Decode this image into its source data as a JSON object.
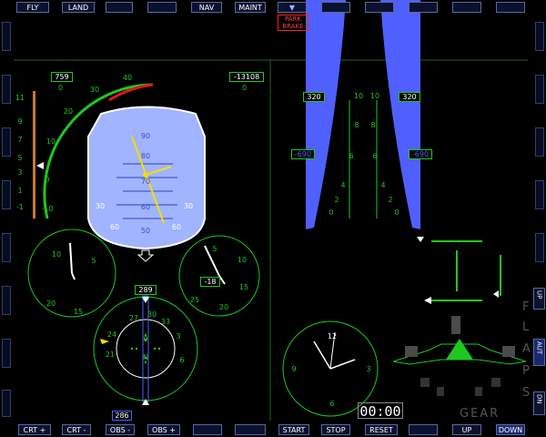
{
  "top_bar": {
    "buttons": [
      "FLY",
      "LAND",
      "",
      "",
      "NAV",
      "MAINT",
      "▼",
      "",
      "",
      "",
      "",
      ""
    ]
  },
  "bottom_bar": {
    "buttons": [
      "CRT +",
      "CRT -",
      "OBS -",
      "OBS +",
      "",
      "",
      "START",
      "STOP",
      "RESET",
      "",
      "UP",
      "DOWN"
    ]
  },
  "right_side": {
    "flaps_up": "UP",
    "flaps_auto": "AUT",
    "flaps_down": "DN",
    "flaps_label": [
      "F",
      "L",
      "A",
      "P",
      "S"
    ],
    "gear_label": "GEAR"
  },
  "warnings": {
    "park_brake": [
      "PARK",
      "BRAKE"
    ]
  },
  "airspeed": {
    "top_value": "759",
    "top_sub": "0",
    "ticks": [
      "-10",
      "0",
      "10",
      "20",
      "30",
      "40"
    ]
  },
  "altimeter": {
    "value": "-13108",
    "sub": "0"
  },
  "vsi": {
    "ticks": [
      "11",
      "9",
      "7",
      "5",
      "3",
      "1",
      "-1"
    ],
    "ticks2": [
      "10",
      "8",
      "6",
      "4",
      "2",
      "0"
    ]
  },
  "attitude": {
    "pitch_labels": [
      "90",
      "80",
      "70",
      "60",
      "50"
    ],
    "side_labels": [
      "30",
      "30",
      "60",
      "60"
    ]
  },
  "gauges": {
    "left_clock_ticks": [
      "10",
      "5",
      "15",
      "20"
    ],
    "right_clock_ticks": [
      "5",
      "10",
      "15",
      "20",
      "25"
    ],
    "right_clock_value": "-18",
    "heading_value": "289",
    "heading_ticks": [
      "27",
      "30",
      "33",
      "24",
      "21",
      "0",
      "N",
      "3",
      "6"
    ],
    "course_value": "286",
    "analog_clock_ticks": [
      "12",
      "3",
      "6",
      "9"
    ]
  },
  "engines": {
    "left_value": "320",
    "right_value": "320",
    "left_bottom": "-690",
    "right_bottom": "-690",
    "scale_left": [
      "10",
      "8",
      "6",
      "4",
      "2",
      "0"
    ],
    "scale_right": [
      "10",
      "8",
      "6",
      "4",
      "2",
      "0"
    ]
  },
  "timer": {
    "display": "00:00"
  },
  "colors": {
    "green": "#1ec81e",
    "blue": "#5060ff",
    "sky": "#a0b4ff",
    "red": "#e01818",
    "yellow": "#f0e000"
  }
}
